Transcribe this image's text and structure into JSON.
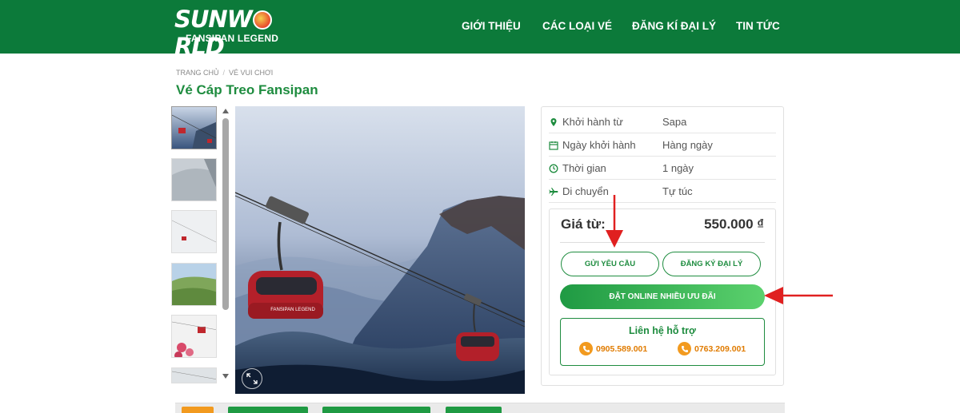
{
  "header": {
    "logo_top": "SUNWORLD",
    "logo_bottom": "FANSIPAN LEGEND",
    "nav": [
      {
        "label": "GIỚI THIỆU"
      },
      {
        "label": "CÁC LOẠI VÉ"
      },
      {
        "label": "ĐĂNG KÍ ĐẠI LÝ"
      },
      {
        "label": "TIN TỨC"
      }
    ],
    "bg_color": "#0c7a3a"
  },
  "breadcrumb": {
    "items": [
      "TRANG CHỦ",
      "VÉ VUI CHƠI"
    ],
    "separator": "/"
  },
  "product": {
    "title": "Vé Cáp Treo Fansipan",
    "accent_color": "#1e8c3f"
  },
  "info": {
    "rows": [
      {
        "icon": "map-marker-icon",
        "label": "Khởi hành từ",
        "value": "Sapa"
      },
      {
        "icon": "calendar-icon",
        "label": "Ngày khởi hành",
        "value": "Hàng ngày"
      },
      {
        "icon": "clock-icon",
        "label": "Thời gian",
        "value": "1 ngày"
      },
      {
        "icon": "plane-icon",
        "label": "Di chuyển",
        "value": "Tự túc"
      }
    ]
  },
  "pricing": {
    "label": "Giá từ:",
    "value": "550.000 ₫",
    "request_button": "GỬI YÊU CẦU",
    "agent_button": "ĐĂNG KÝ ĐẠI LÝ",
    "online_button": "ĐẶT ONLINE NHIỀU ƯU ĐÃI"
  },
  "support": {
    "title": "Liên hệ hỗ trợ",
    "phones": [
      "0905.589.001",
      "0763.209.001"
    ]
  },
  "gallery": {
    "thumbnail_count": 6,
    "cabin_label": "FANSIPAN LEGEND"
  }
}
